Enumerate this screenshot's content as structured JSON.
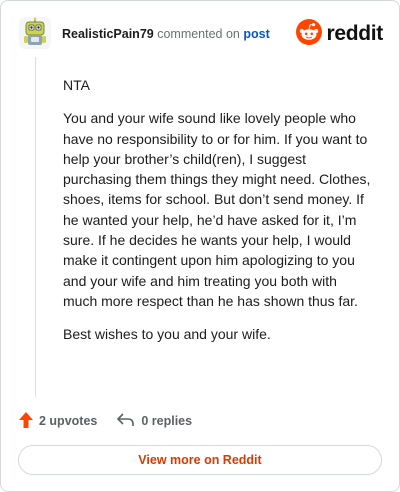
{
  "header": {
    "username": "RealisticPain79",
    "commented_on": "commented on",
    "post_link": "post",
    "brand": "reddit"
  },
  "colors": {
    "brand_orange": "#ff4500",
    "link_blue": "#0a57c2",
    "cta_orange": "#d93a00"
  },
  "icons": {
    "avatar": "snoo-avatar-icon",
    "brand": "reddit-logo-icon",
    "upvote": "upvote-arrow-icon",
    "reply": "reply-arrow-icon"
  },
  "comment": {
    "paragraphs": [
      "NTA",
      "You and your wife sound like lovely people who have no responsibility to or for him. If you want to help your brother’s child(ren), I suggest purchasing them things they might need. Clothes, shoes, items for school. But don’t send money. If he wanted your help, he’d have asked for it, I’m sure. If he decides he wants your help, I would make it contingent upon him apologizing to you and your wife and him treating you both with much more respect than he has shown thus far.",
      "Best wishes to you and your wife."
    ]
  },
  "actions": {
    "upvotes": "2 upvotes",
    "replies": "0 replies"
  },
  "cta": {
    "label": "View more on Reddit"
  }
}
